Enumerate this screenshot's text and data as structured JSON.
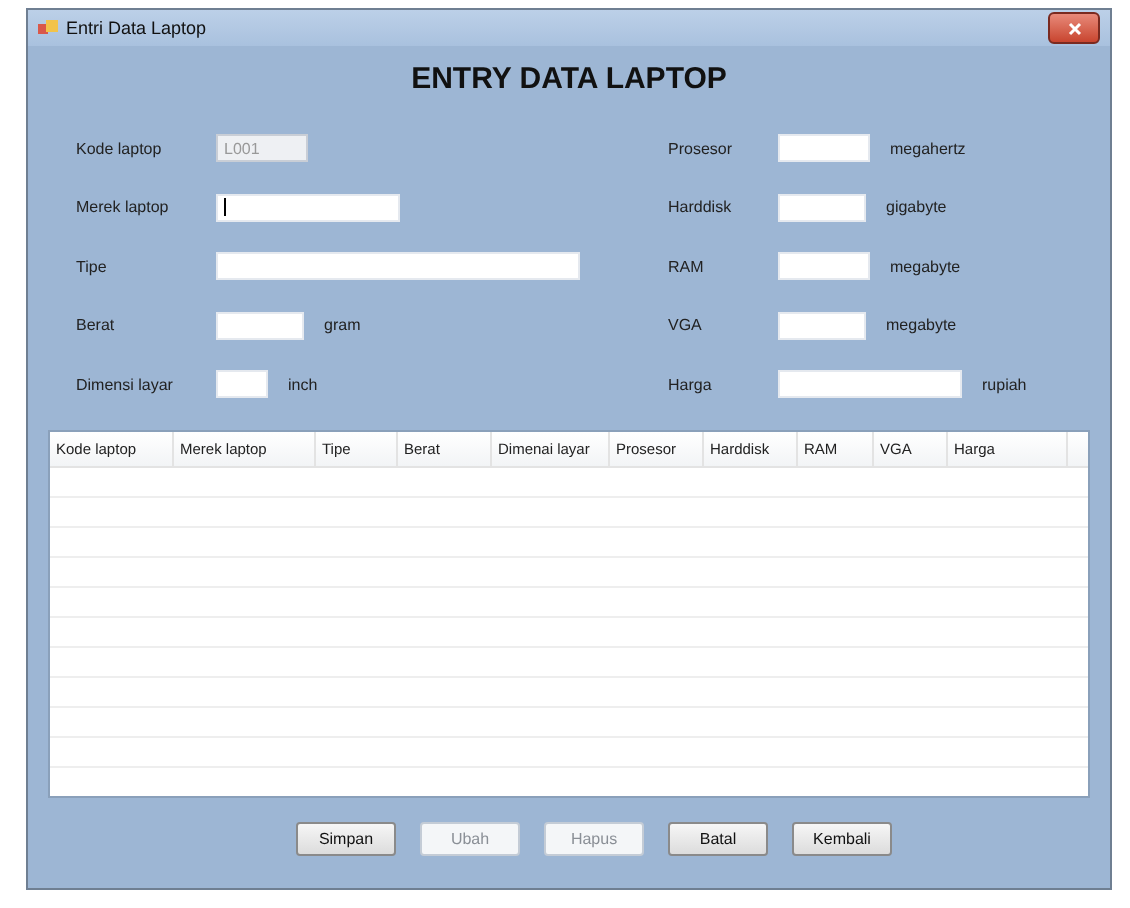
{
  "window": {
    "title": "Entri Data Laptop"
  },
  "heading": "ENTRY DATA LAPTOP",
  "left_fields": [
    {
      "label": "Kode laptop",
      "value": "L001",
      "disabled": true
    },
    {
      "label": "Merek laptop",
      "disabled": false,
      "focused": true
    },
    {
      "label": "Tipe",
      "disabled": false
    },
    {
      "label": "Berat",
      "disabled": false,
      "unit": "gram"
    },
    {
      "label": "Dimensi layar",
      "disabled": false,
      "unit": "inch"
    }
  ],
  "right_fields": [
    {
      "label": "Prosesor",
      "unit": "megahertz"
    },
    {
      "label": "Harddisk",
      "unit": "gigabyte"
    },
    {
      "label": "RAM",
      "unit": "megabyte"
    },
    {
      "label": "VGA",
      "unit": "megabyte"
    },
    {
      "label": "Harga",
      "unit": "rupiah"
    }
  ],
  "table": {
    "columns": [
      "Kode laptop",
      "Merek laptop",
      "Tipe",
      "Berat",
      "Dimenai layar",
      "Prosesor",
      "Harddisk",
      "RAM",
      "VGA",
      "Harga"
    ]
  },
  "buttons": [
    {
      "label": "Simpan",
      "disabled": false
    },
    {
      "label": "Ubah",
      "disabled": true
    },
    {
      "label": "Hapus",
      "disabled": true
    },
    {
      "label": "Batal",
      "disabled": false
    },
    {
      "label": "Kembali",
      "disabled": false
    }
  ]
}
